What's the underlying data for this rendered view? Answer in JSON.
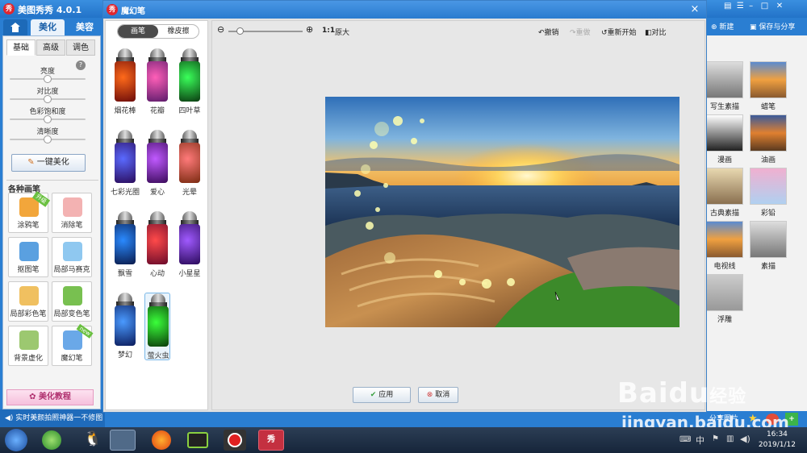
{
  "app": {
    "title": "美图秀秀 4.0.1",
    "logo_text": "秀"
  },
  "nav": {
    "home_icon": "home-icon",
    "tabs": [
      "美化",
      "美容"
    ]
  },
  "left": {
    "subtabs": [
      "基础",
      "高级",
      "调色"
    ],
    "sliders": [
      {
        "label": "亮度",
        "value": 0.5
      },
      {
        "label": "对比度",
        "value": 0.5
      },
      {
        "label": "色彩饱和度",
        "value": 0.5
      },
      {
        "label": "清晰度",
        "value": 0.5
      }
    ],
    "one_key": "一键美化",
    "brushes_title": "各种画笔",
    "tools": [
      {
        "label": "涂鸦笔",
        "badge": "升级",
        "color": "#f2a63b"
      },
      {
        "label": "消除笔",
        "badge": "",
        "color": "#f3b2b2"
      },
      {
        "label": "抠图笔",
        "badge": "",
        "color": "#5aa0e0"
      },
      {
        "label": "局部马赛克",
        "badge": "",
        "color": "#8fc8f0"
      },
      {
        "label": "局部彩色笔",
        "badge": "",
        "color": "#f0c060"
      },
      {
        "label": "局部变色笔",
        "badge": "",
        "color": "#78c050"
      },
      {
        "label": "背景虚化",
        "badge": "",
        "color": "#9cc870"
      },
      {
        "label": "魔幻笔",
        "badge": "new",
        "color": "#6aa8e8"
      }
    ],
    "tutorial": "美化教程",
    "status": "实时美颜拍照神器一不修图"
  },
  "right": {
    "new_label": "新建",
    "save_label": "保存与分享",
    "effects": [
      {
        "label": "写生素描",
        "tone": "gray"
      },
      {
        "label": "蜡笔",
        "tone": "warm"
      },
      {
        "label": "漫画",
        "tone": "bw"
      },
      {
        "label": "油画",
        "tone": "warm2"
      },
      {
        "label": "古典素描",
        "tone": "sepia"
      },
      {
        "label": "彩铅",
        "tone": "pastel"
      },
      {
        "label": "电视线",
        "tone": "warm"
      },
      {
        "label": "素描",
        "tone": "gray"
      },
      {
        "label": "浮雕",
        "tone": "gray2"
      }
    ],
    "share_label": "分享图片"
  },
  "dialog": {
    "title": "魔幻笔",
    "close": "×",
    "modes": [
      "画笔",
      "橡皮擦"
    ],
    "zoom_label": "1:1",
    "zoom_text": "原大",
    "zoom_value": 0.15,
    "undo": "撤销",
    "redo": "重做",
    "restart": "重新开始",
    "compare": "对比",
    "apply": "应用",
    "cancel": "取消",
    "pens": [
      {
        "label": "烟花棒",
        "c1": "#ff6a1a",
        "c2": "#6a0a0a"
      },
      {
        "label": "花瓣",
        "c1": "#ff5fb8",
        "c2": "#5a1a6a"
      },
      {
        "label": "四叶草",
        "c1": "#3aff5a",
        "c2": "#0a3a10"
      },
      {
        "label": "七彩光圈",
        "c1": "#5a6aff",
        "c2": "#2a0a5a"
      },
      {
        "label": "爱心",
        "c1": "#c05aff",
        "c2": "#3a0a5a"
      },
      {
        "label": "光晕",
        "c1": "#ff7a7a",
        "c2": "#7a2a10"
      },
      {
        "label": "飘雪",
        "c1": "#2a8aff",
        "c2": "#0a1a4a"
      },
      {
        "label": "心动",
        "c1": "#ff4a4a",
        "c2": "#6a0a2a"
      },
      {
        "label": "小星星",
        "c1": "#a05aff",
        "c2": "#2a0a5a"
      },
      {
        "label": "梦幻",
        "c1": "#4a9aff",
        "c2": "#0a1a5a"
      },
      {
        "label": "萤火虫",
        "c1": "#3aff3a",
        "c2": "#0a3a0a"
      }
    ],
    "selected_pen": "萤火虫"
  },
  "taskbar": {
    "time": "16:34",
    "date": "2019/1/12",
    "lang": "中"
  },
  "watermark": {
    "brand": "Baidu",
    "brand_cn": "经验",
    "url": "jingyan.baidu.com"
  }
}
